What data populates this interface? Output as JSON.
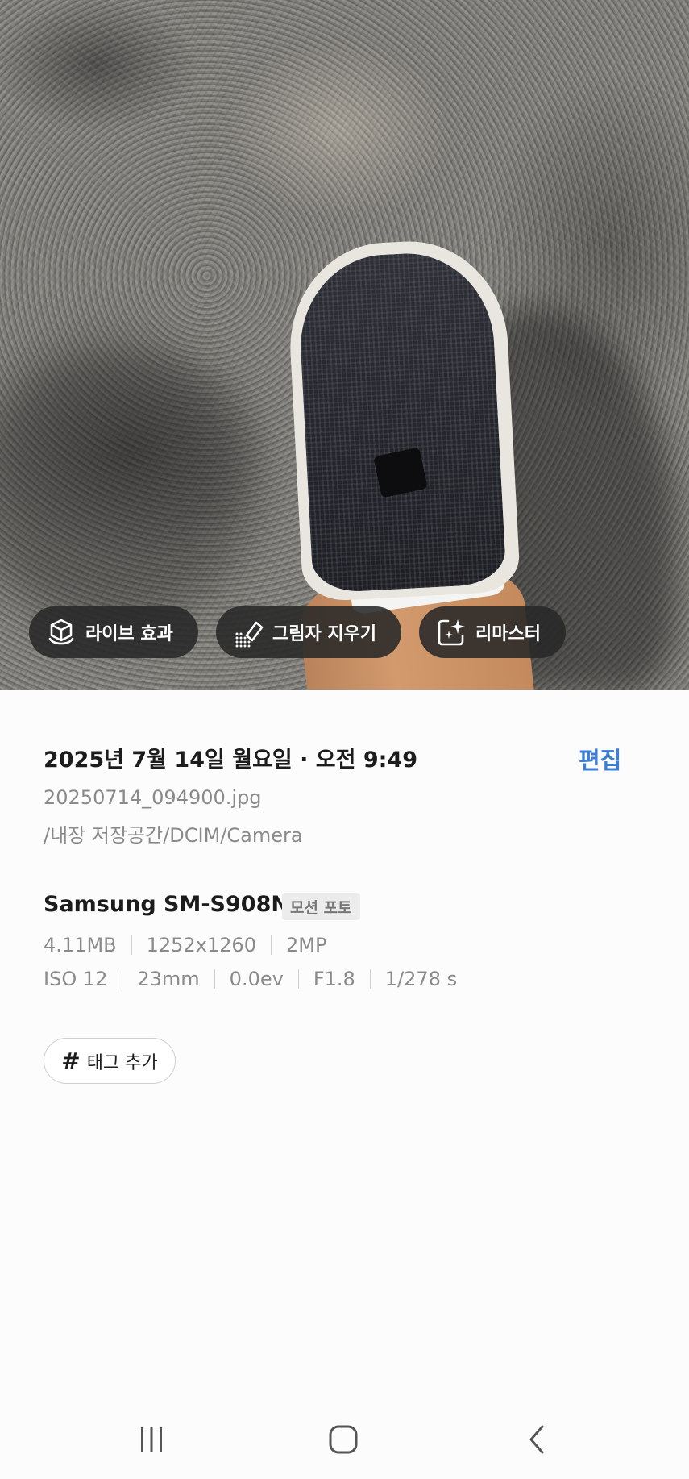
{
  "photo_actions": [
    {
      "label": "라이브 효과",
      "icon": "live-effect-icon"
    },
    {
      "label": "그림자 지우기",
      "icon": "shadow-eraser-icon"
    },
    {
      "label": "리마스터",
      "icon": "remaster-icon"
    }
  ],
  "details": {
    "datetime": "2025년 7월 14일 월요일 · 오전 9:49",
    "edit_label": "편집",
    "filename": "20250714_094900.jpg",
    "path": "/내장 저장공간/DCIM/Camera"
  },
  "camera": {
    "model": "Samsung SM-S908N",
    "badge": "모션 포토",
    "file_size": "4.11MB",
    "resolution": "1252x1260",
    "megapixels": "2MP",
    "iso": "ISO 12",
    "focal_length": "23mm",
    "exposure": "0.0ev",
    "aperture": "F1.8",
    "shutter": "1/278 s"
  },
  "tags": {
    "add_label": "태그 추가"
  },
  "navigation": {
    "recents": "recents-icon",
    "home": "home-icon",
    "back": "back-icon"
  },
  "colors": {
    "accent": "#3b7ed6",
    "chip_bg": "#282828"
  }
}
